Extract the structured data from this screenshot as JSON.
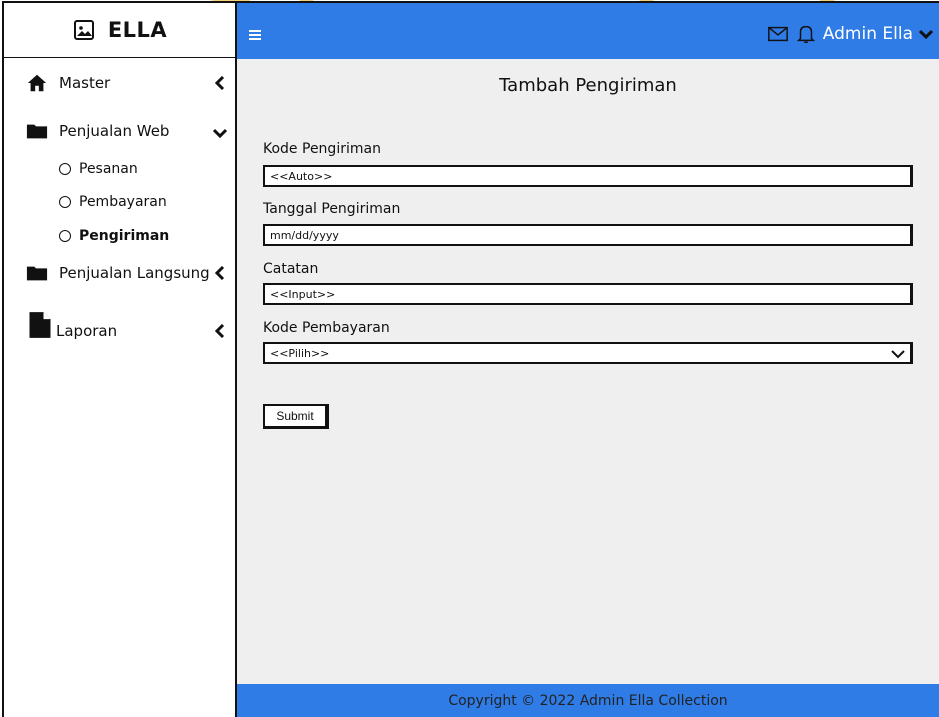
{
  "brand": {
    "name": "ELLA",
    "logo_icon": "image-icon"
  },
  "sidebar": {
    "items": [
      {
        "label": "Master",
        "icon": "home-icon",
        "chevron": "chevron-left-icon"
      },
      {
        "label": "Penjualan Web",
        "icon": "folder-icon",
        "chevron": "chevron-down-icon",
        "children": [
          {
            "label": "Pesanan"
          },
          {
            "label": "Pembayaran"
          },
          {
            "label": "Pengiriman",
            "active": true
          }
        ]
      },
      {
        "label": "Penjualan Langsung",
        "icon": "folder-icon",
        "chevron": "chevron-left-icon"
      },
      {
        "label": "Laporan",
        "icon": "file-icon",
        "chevron": "chevron-left-icon"
      }
    ]
  },
  "topbar": {
    "menu_icon": "hamburger-icon",
    "user_name": "Admin Ella",
    "icons": [
      "mail-icon",
      "bell-icon",
      "chevron-down-icon"
    ]
  },
  "form": {
    "title": "Tambah Pengiriman",
    "fields": [
      {
        "label": "Kode Pengiriman",
        "value": "<<Auto>>"
      },
      {
        "label": "Tanggal Pengiriman",
        "value": "mm/dd/yyyy"
      },
      {
        "label": "Catatan",
        "value": "<<Input>>"
      },
      {
        "label": "Kode Pembayaran",
        "value": "<<Pilih>>"
      }
    ],
    "submit_label": "Submit"
  },
  "footer": {
    "text": "Copyright © 2022 Admin Ella Collection"
  },
  "colors": {
    "primary": "#2f7ce6",
    "content_bg": "#efefef",
    "watermark": "#f6c6c0"
  }
}
